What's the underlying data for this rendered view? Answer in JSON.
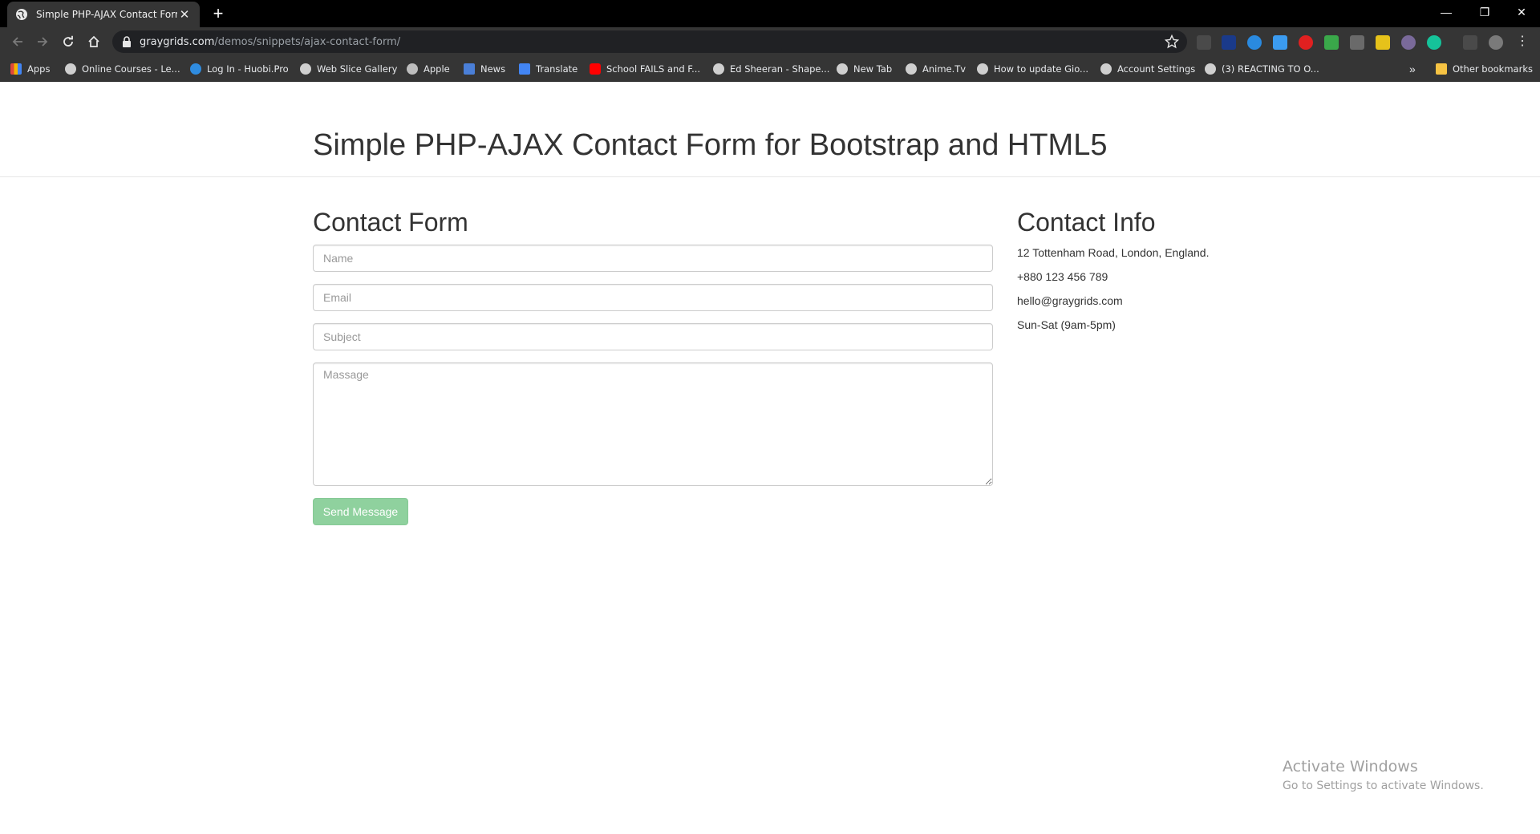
{
  "browser": {
    "tab_title": "Simple PHP-AJAX Contact Form f",
    "tab_close": "✕",
    "new_tab": "+",
    "url_domain": "graygrids.com",
    "url_path": "/demos/snippets/ajax-contact-form/",
    "window_controls": [
      "—",
      "❐",
      "✕"
    ],
    "bookmarks": [
      {
        "label": "Apps",
        "icon": "apps-grid-icon",
        "color": "#e0473a"
      },
      {
        "label": "Online Courses - Le...",
        "icon": "globe-icon",
        "color": "#cfcfcf"
      },
      {
        "label": "Log In - Huobi.Pro",
        "icon": "huobi-icon",
        "color": "#2f8ce0"
      },
      {
        "label": "Web Slice Gallery",
        "icon": "globe-icon",
        "color": "#cfcfcf"
      },
      {
        "label": "Apple",
        "icon": "apple-icon",
        "color": "#bdbdbd"
      },
      {
        "label": "News",
        "icon": "news-icon",
        "color": "#4a7fd8"
      },
      {
        "label": "Translate",
        "icon": "translate-icon",
        "color": "#4285f4"
      },
      {
        "label": "School FAILS and F...",
        "icon": "youtube-icon",
        "color": "#ff0000"
      },
      {
        "label": "Ed Sheeran - Shape...",
        "icon": "globe-icon",
        "color": "#cfcfcf"
      },
      {
        "label": "New Tab",
        "icon": "globe-icon",
        "color": "#cfcfcf"
      },
      {
        "label": "Anime.Tv",
        "icon": "globe-icon",
        "color": "#cfcfcf"
      },
      {
        "label": "How to update Gio...",
        "icon": "globe-icon",
        "color": "#cfcfcf"
      },
      {
        "label": "Account Settings",
        "icon": "globe-icon",
        "color": "#cfcfcf"
      },
      {
        "label": "(3) REACTING TO O...",
        "icon": "globe-icon",
        "color": "#cfcfcf"
      }
    ],
    "more_bookmarks": "»",
    "other_bookmarks": "Other bookmarks"
  },
  "page": {
    "title": "Simple PHP-AJAX Contact Form for Bootstrap and HTML5",
    "form_heading": "Contact Form",
    "name_placeholder": "Name",
    "email_placeholder": "Email",
    "subject_placeholder": "Subject",
    "message_placeholder": "Massage",
    "send_label": "Send Message",
    "info_heading": "Contact Info",
    "address": "12 Tottenham Road, London, England.",
    "phone": "+880 123 456 789",
    "email": "hello@graygrids.com",
    "hours": "Sun-Sat (9am-5pm)"
  },
  "watermark": {
    "line1": "Activate Windows",
    "line2": "Go to Settings to activate Windows."
  },
  "colors": {
    "button": "#8fd19e",
    "text": "#333333"
  }
}
